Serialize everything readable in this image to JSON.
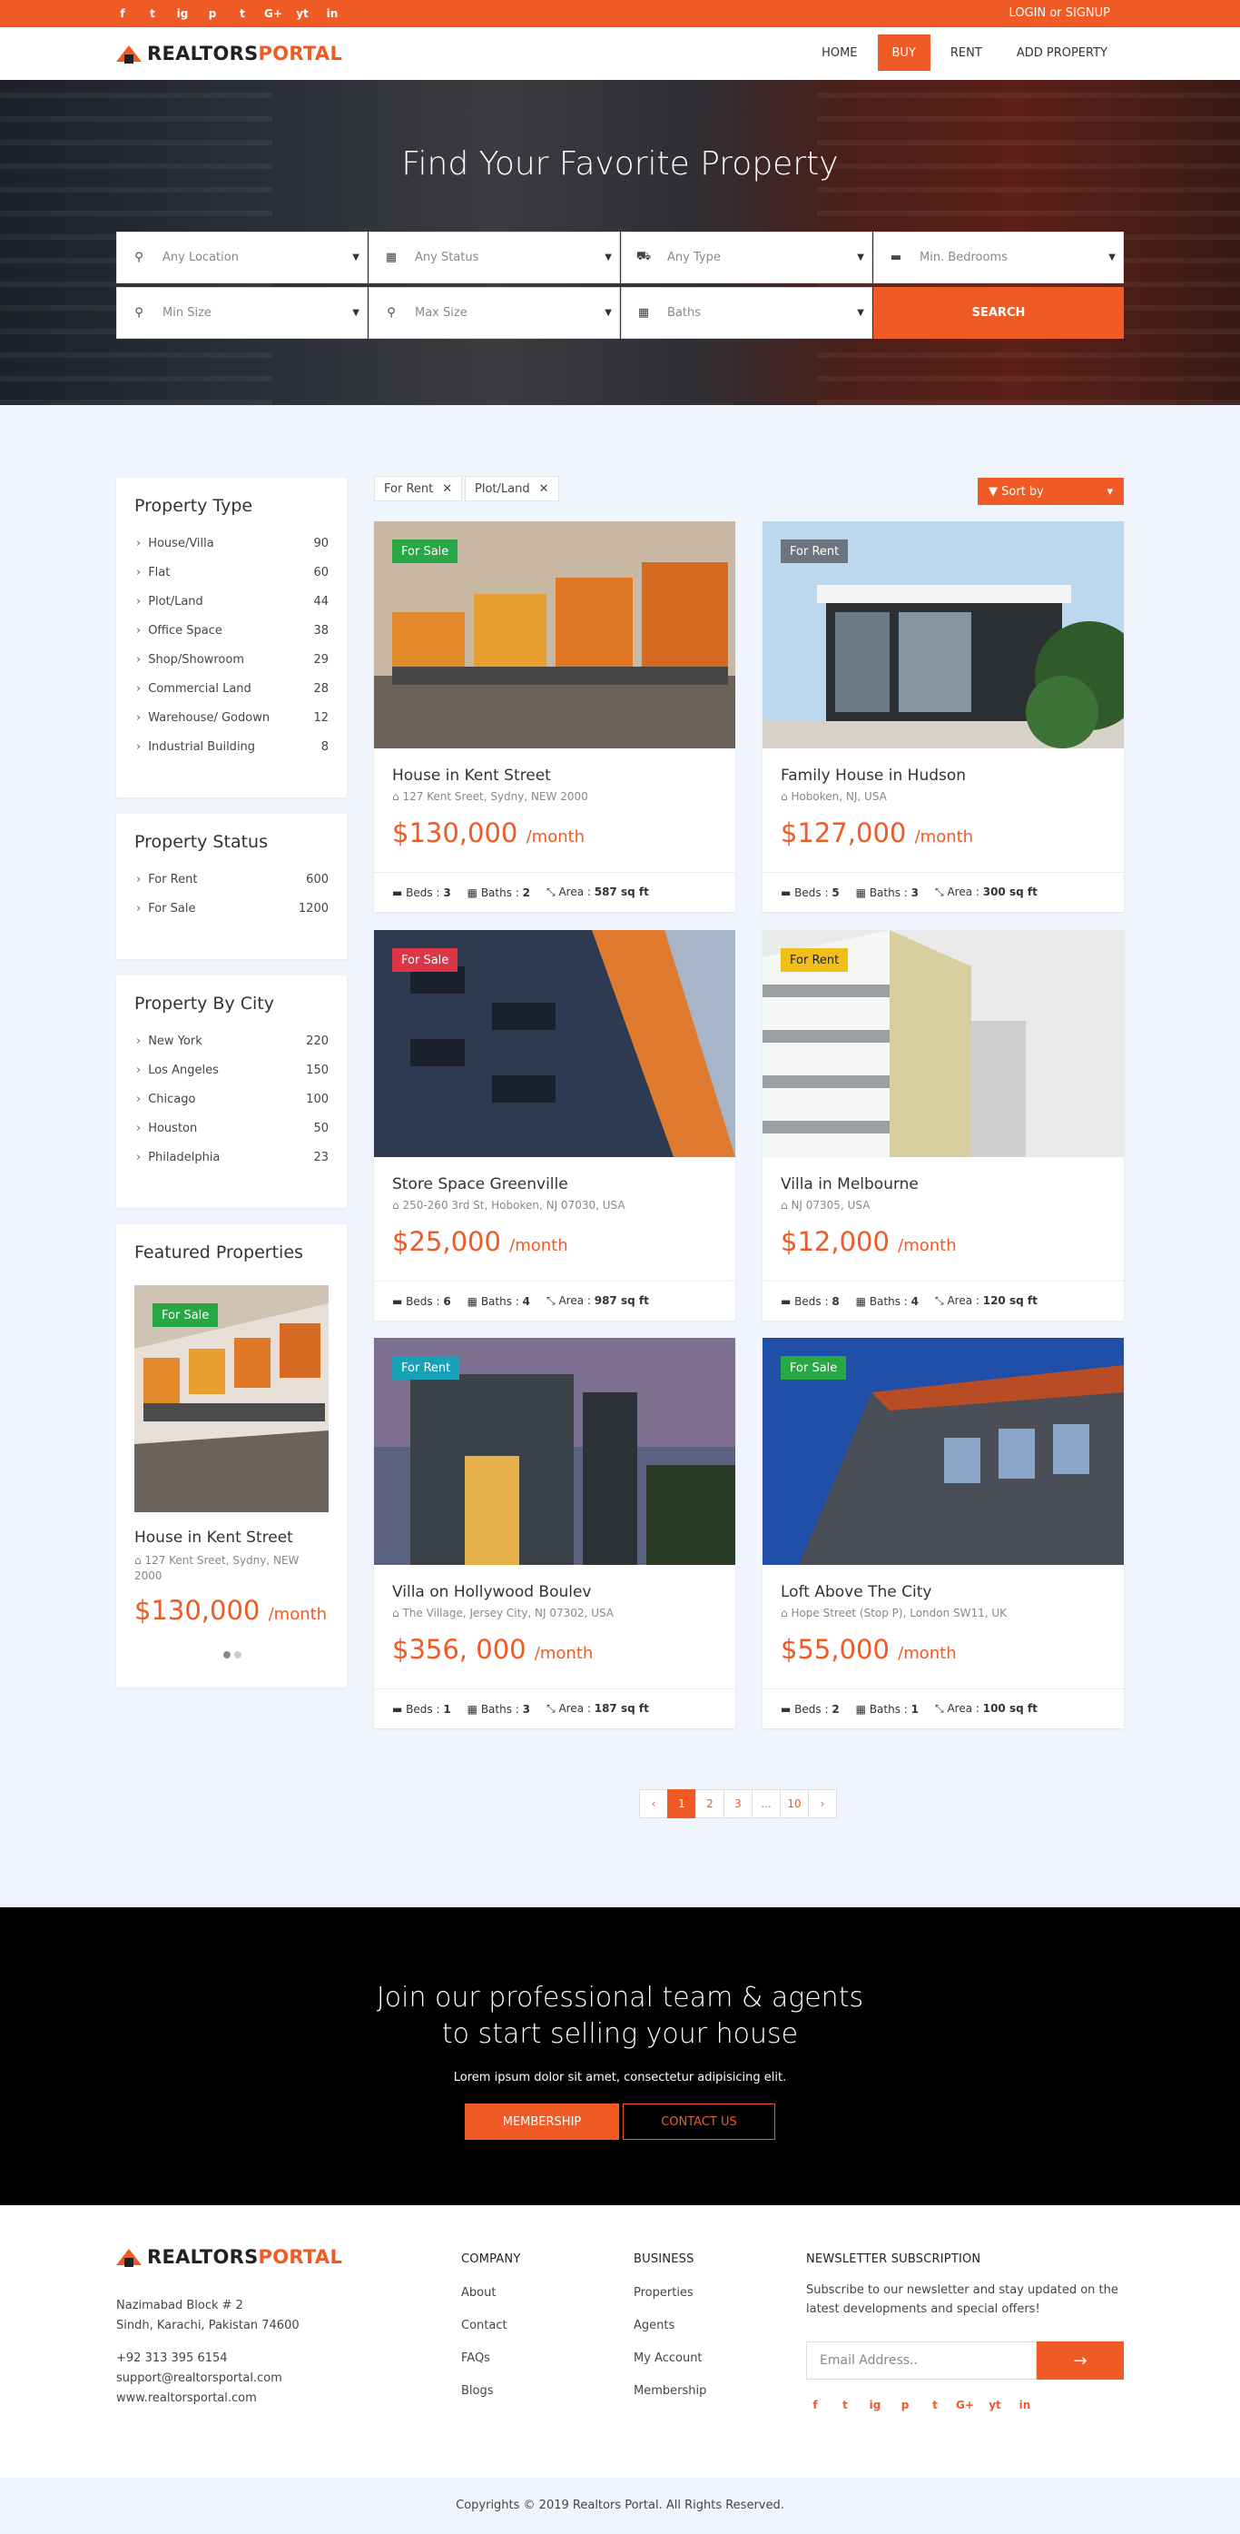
{
  "topbar": {
    "social_icons": [
      "f",
      "t",
      "ig",
      "p",
      "t",
      "G+",
      "yt",
      "in"
    ],
    "login": "LOGIN or SIGNUP"
  },
  "brand": {
    "part1": "REALTORS",
    "part2": "PORTAL",
    "accent": "#f05a24"
  },
  "nav": [
    "HOME",
    "BUY",
    "RENT",
    "ADD PROPERTY"
  ],
  "hero": {
    "title": "Find Your Favorite Property",
    "fields": [
      {
        "icon": "⚲",
        "placeholder": "Any Location"
      },
      {
        "icon": "▦",
        "placeholder": "Any Status"
      },
      {
        "icon": "⛟",
        "placeholder": "Any Type"
      },
      {
        "icon": "▬",
        "placeholder": "Min. Bedrooms"
      },
      {
        "icon": "⚲",
        "placeholder": "Min Size"
      },
      {
        "icon": "⚲",
        "placeholder": "Max Size"
      },
      {
        "icon": "▦",
        "placeholder": "Baths"
      }
    ],
    "search": "SEARCH"
  },
  "sidebar": {
    "type_title": "Property Type",
    "types": [
      [
        "House/Villa",
        "90"
      ],
      [
        "Flat",
        "60"
      ],
      [
        "Plot/Land",
        "44"
      ],
      [
        "Office Space",
        "38"
      ],
      [
        "Shop/Showroom",
        "29"
      ],
      [
        "Commercial Land",
        "28"
      ],
      [
        "Warehouse/ Godown",
        "12"
      ],
      [
        "Industrial Building",
        "8"
      ]
    ],
    "status_title": "Property Status",
    "statuses": [
      [
        "For Rent",
        "600"
      ],
      [
        "For Sale",
        "1200"
      ]
    ],
    "city_title": "Property By City",
    "cities": [
      [
        "New York",
        "220"
      ],
      [
        "Los Angeles",
        "150"
      ],
      [
        "Chicago",
        "100"
      ],
      [
        "Houston",
        "50"
      ],
      [
        "Philadelphia",
        "23"
      ]
    ],
    "featured_title": "Featured Properties",
    "featured": {
      "badge": "For Sale",
      "title": "House in Kent Street",
      "address": "127 Kent Sreet, Sydny, NEW 2000",
      "price": "$130,000",
      "per": "/month"
    }
  },
  "filters": [
    "For Rent",
    "Plot/Land"
  ],
  "sort_label": "Sort by",
  "listings": [
    {
      "badge": "For Sale",
      "badge_color": "#28a745",
      "title": "House in Kent Street",
      "address": "127 Kent Sreet, Sydny, NEW 2000",
      "price": "$130,000",
      "per": "/month",
      "beds": "3",
      "baths": "2",
      "area": "587 sq ft"
    },
    {
      "badge": "For Rent",
      "badge_color": "#6c757d",
      "title": "Family House in Hudson",
      "address": "Hoboken, NJ, USA",
      "price": "$127,000",
      "per": "/month",
      "beds": "5",
      "baths": "3",
      "area": "300 sq ft"
    },
    {
      "badge": "For Sale",
      "badge_color": "#dc3545",
      "title": "Store Space Greenville",
      "address": "250-260 3rd St, Hoboken, NJ 07030, USA",
      "price": "$25,000",
      "per": "/month",
      "beds": "6",
      "baths": "4",
      "area": "987 sq ft"
    },
    {
      "badge": "For Rent",
      "badge_color": "#f0c018",
      "title": "Villa in Melbourne",
      "address": "NJ 07305, USA",
      "price": "$12,000",
      "per": "/month",
      "beds": "8",
      "baths": "4",
      "area": "120 sq ft"
    },
    {
      "badge": "For Rent",
      "badge_color": "#17a2b8",
      "title": "Villa on Hollywood Boulev",
      "address": "The Village, Jersey City, NJ 07302, USA",
      "price": "$356, 000",
      "per": "/month",
      "beds": "1",
      "baths": "3",
      "area": "187 sq ft"
    },
    {
      "badge": "For Sale",
      "badge_color": "#28a745",
      "title": "Loft Above The City",
      "address": "Hope Street (Stop P), London SW11, UK",
      "price": "$55,000",
      "per": "/month",
      "beds": "2",
      "baths": "1",
      "area": "100 sq ft"
    }
  ],
  "meta_labels": {
    "beds": "Beds",
    "baths": "Baths",
    "area": "Area"
  },
  "pagination": [
    "‹",
    "1",
    "2",
    "3",
    "...",
    "10",
    "›"
  ],
  "cta": {
    "line1": "Join our professional team & agents",
    "line2": "to start selling your house",
    "text": "Lorem ipsum dolor sit amet, consectetur adipisicing elit.",
    "btn1": "MEMBERSHIP",
    "btn2": "CONTACT US"
  },
  "footer": {
    "addr1": "Nazimabad Block # 2",
    "addr2": "Sindh, Karachi, Pakistan 74600",
    "phone": "+92 313 395 6154",
    "email": "support@realtorsportal.com",
    "web": "www.realtorsportal.com",
    "company_title": "COMPANY",
    "company": [
      "About",
      "Contact",
      "FAQs",
      "Blogs"
    ],
    "business_title": "BUSINESS",
    "business": [
      "Properties",
      "Agents",
      "My Account",
      "Membership"
    ],
    "news_title": "NEWSLETTER SUBSCRIPTION",
    "news_text": "Subscribe to our newsletter and stay updated on the latest developments and special offers!",
    "email_placeholder": "Email Address..",
    "copyright": "Copyrights © 2019 Realtors Portal. All Rights Reserved."
  }
}
